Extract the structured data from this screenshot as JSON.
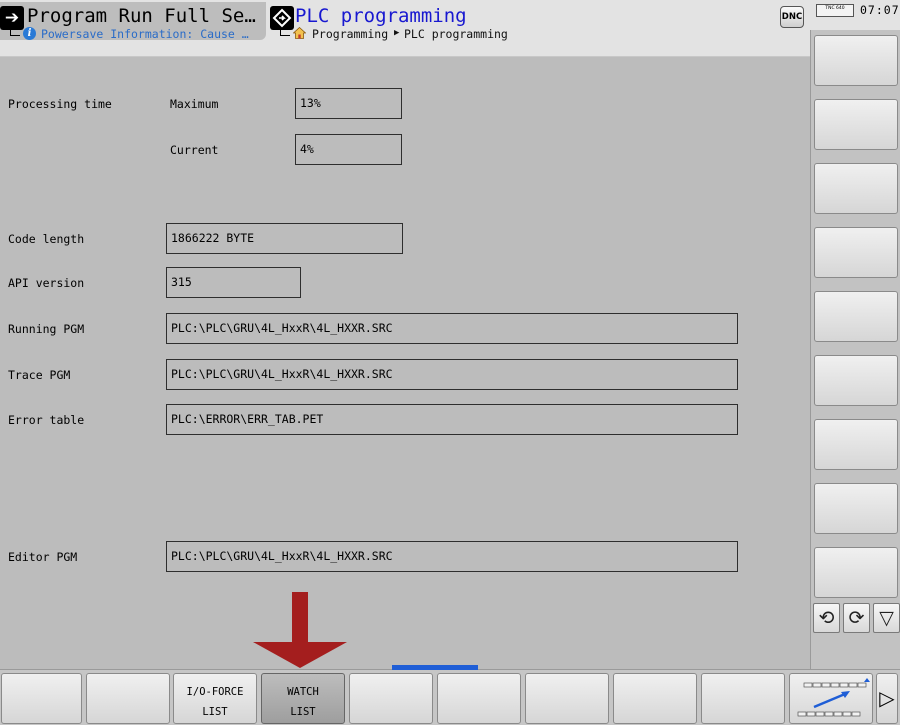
{
  "header": {
    "left_mode": {
      "title": "Program Run Full Se…",
      "icon": "mode-arrow-icon",
      "status": "Powersave Information: Cause …"
    },
    "right_mode": {
      "title": "PLC programming",
      "icon": "plc-diamond-icon",
      "breadcrumb": [
        "Programming",
        "PLC programming"
      ]
    },
    "dnc_label": "DNC",
    "logo_text": "TNC 640",
    "clock": "07:07"
  },
  "main": {
    "processing_time_label": "Processing time",
    "maximum_label": "Maximum",
    "maximum_value": "13%",
    "current_label": "Current",
    "current_value": "4%",
    "code_length_label": "Code length",
    "code_length_value": "1866222 BYTE",
    "api_version_label": "API version",
    "api_version_value": "315",
    "running_pgm_label": "Running PGM",
    "running_pgm_value": "PLC:\\PLC\\GRU\\4L_HxxR\\4L_HXXR.SRC",
    "trace_pgm_label": "Trace PGM",
    "trace_pgm_value": "PLC:\\PLC\\GRU\\4L_HxxR\\4L_HXXR.SRC",
    "error_table_label": "Error table",
    "error_table_value": "PLC:\\ERROR\\ERR_TAB.PET",
    "editor_pgm_label": "Editor PGM",
    "editor_pgm_value": "PLC:\\PLC\\GRU\\4L_HxxR\\4L_HXXR.SRC"
  },
  "softkeys": {
    "io_force": {
      "line1": "I/O-FORCE",
      "line2": "LIST"
    },
    "watch": {
      "line1": "WATCH",
      "line2": "LIST"
    }
  },
  "colors": {
    "accent_title": "#1818d0",
    "info_text": "#2a6cc8",
    "arrow_annotation": "#a41e1e",
    "active_bar": "#1f5ed6"
  }
}
